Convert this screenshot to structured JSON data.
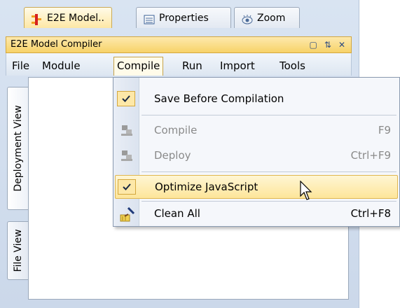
{
  "tabs": [
    {
      "label": "E2E Model..",
      "icon": "e2e-model-icon",
      "active": true
    },
    {
      "label": "Properties",
      "icon": "properties-icon",
      "active": false
    },
    {
      "label": "Zoom",
      "icon": "zoom-icon",
      "active": false
    }
  ],
  "panel": {
    "title": "E2E Model Compiler",
    "buttons": [
      "pin-icon",
      "dock-icon",
      "close-icon"
    ]
  },
  "menubar": {
    "items": [
      "File",
      "Module",
      "Compile",
      "Run",
      "Import",
      "Tools"
    ],
    "open": "Compile"
  },
  "side_tabs": [
    "Deployment View",
    "File View"
  ],
  "compile_menu": {
    "items": [
      {
        "label": "Save Before Compilation",
        "shortcut": "",
        "checked": true,
        "enabled": true
      },
      {
        "label": "Compile",
        "shortcut": "F9",
        "icon": "compile-icon",
        "enabled": false
      },
      {
        "label": "Deploy",
        "shortcut": "Ctrl+F9",
        "icon": "deploy-icon",
        "enabled": false
      },
      {
        "label": "Optimize JavaScript",
        "shortcut": "",
        "checked": true,
        "enabled": true,
        "highlighted": true
      },
      {
        "label": "Clean All",
        "shortcut": "Ctrl+F8",
        "icon": "broom-icon",
        "enabled": true
      }
    ]
  },
  "colors": {
    "highlight": "#fde59a",
    "titlebar": "#f7d268",
    "menubar": "#dde6f1"
  }
}
